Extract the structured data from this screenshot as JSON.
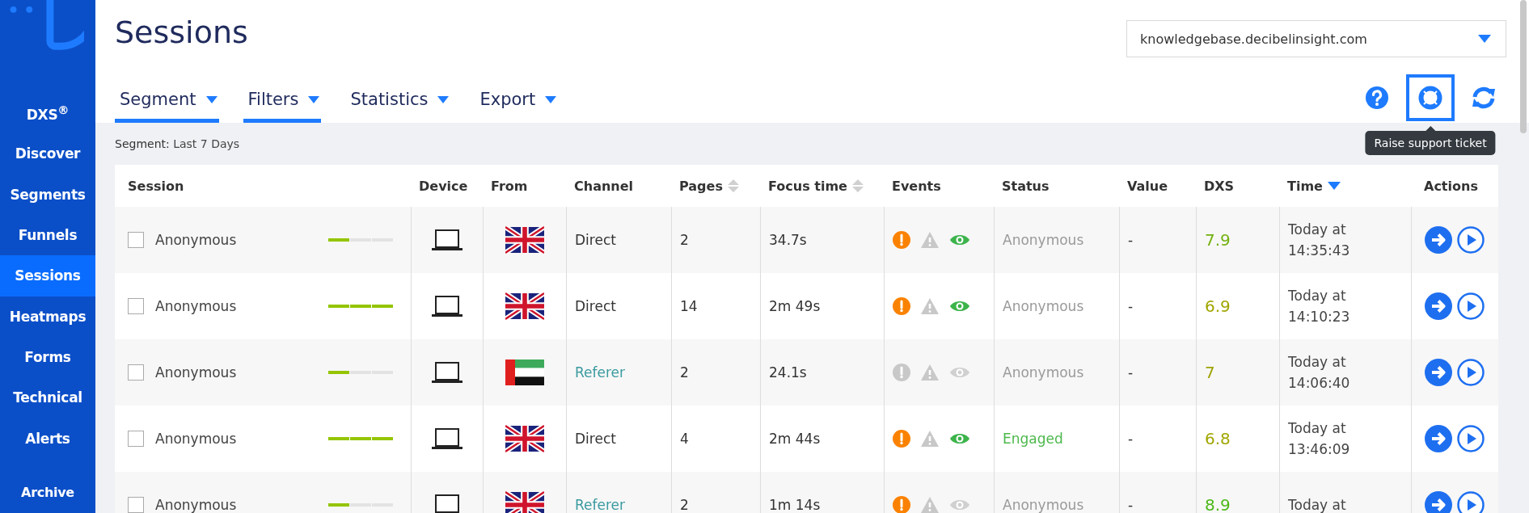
{
  "sidebar": {
    "items": [
      {
        "label": "DXS$^{®}$",
        "selected": false
      },
      {
        "label": "Discover",
        "selected": false
      },
      {
        "label": "Segments",
        "selected": false
      },
      {
        "label": "Funnels",
        "selected": false
      },
      {
        "label": "Sessions",
        "selected": true
      },
      {
        "label": "Heatmaps",
        "selected": false
      },
      {
        "label": "Forms",
        "selected": false
      },
      {
        "label": "Technical",
        "selected": false
      },
      {
        "label": "Alerts",
        "selected": false
      },
      {
        "label": "Archive",
        "selected": false
      }
    ]
  },
  "page_title": "Sessions",
  "site_select": {
    "value": "knowledgebase.decibelinsight.com"
  },
  "tabs": [
    {
      "label": "Segment",
      "selected": true
    },
    {
      "label": "Filters",
      "selected": true
    },
    {
      "label": "Statistics",
      "selected": false
    },
    {
      "label": "Export",
      "selected": false
    }
  ],
  "toolbar": [
    {
      "kind": "help",
      "highlighted": false
    },
    {
      "kind": "support",
      "highlighted": true,
      "tooltip": "Raise support ticket"
    },
    {
      "kind": "refresh",
      "highlighted": false
    }
  ],
  "segment_label": "Segment:",
  "segment_value": "Last 7 Days",
  "table": {
    "columns": [
      {
        "label": "Session"
      },
      {
        "label": "Device"
      },
      {
        "label": "From"
      },
      {
        "label": "Channel"
      },
      {
        "label": "Pages",
        "kind": "sortable"
      },
      {
        "label": "Focus time",
        "kind": "sortable"
      },
      {
        "label": "Events"
      },
      {
        "label": "Status"
      },
      {
        "label": "Value"
      },
      {
        "label": "DXS"
      },
      {
        "label": "Time",
        "kind": "sorted"
      },
      {
        "label": "Actions"
      }
    ],
    "rows": [
      {
        "checked": false,
        "session": "Anonymous",
        "level": 0.33,
        "from": {
          "kind": "uk"
        },
        "channel": {
          "text": "Direct",
          "color": "#333333"
        },
        "pages": "2",
        "focus_time": "34.7s",
        "events": {
          "error": true,
          "warning": false,
          "viewed": true
        },
        "status": {
          "text": "Anonymous",
          "color": "#9a9a9a"
        },
        "value": "-",
        "dxs": {
          "text": "7.9",
          "color": "#73b10f"
        },
        "time": "Today at 14:35:43"
      },
      {
        "checked": false,
        "session": "Anonymous",
        "level": 1,
        "from": {
          "kind": "uk"
        },
        "channel": {
          "text": "Direct",
          "color": "#333333"
        },
        "pages": "14",
        "focus_time": "2m 49s",
        "events": {
          "error": true,
          "warning": false,
          "viewed": true
        },
        "status": {
          "text": "Anonymous",
          "color": "#9a9a9a"
        },
        "value": "-",
        "dxs": {
          "text": "6.9",
          "color": "#a0a600"
        },
        "time": "Today at 14:10:23"
      },
      {
        "checked": false,
        "session": "Anonymous",
        "level": 0.33,
        "from": {
          "kind": "uae"
        },
        "channel": {
          "text": "Referer",
          "color": "#3a9a9f"
        },
        "pages": "2",
        "focus_time": "24.1s",
        "events": {
          "error": false,
          "warning": false,
          "viewed": false
        },
        "status": {
          "text": "Anonymous",
          "color": "#9a9a9a"
        },
        "value": "-",
        "dxs": {
          "text": "7",
          "color": "#9ea300"
        },
        "time": "Today at 14:06:40"
      },
      {
        "checked": false,
        "session": "Anonymous",
        "level": 1,
        "from": {
          "kind": "uk"
        },
        "channel": {
          "text": "Direct",
          "color": "#333333"
        },
        "pages": "4",
        "focus_time": "2m 44s",
        "events": {
          "error": true,
          "warning": false,
          "viewed": true
        },
        "status": {
          "text": "Engaged",
          "color": "#4cb84c"
        },
        "value": "-",
        "dxs": {
          "text": "6.8",
          "color": "#a0a600"
        },
        "time": "Today at 13:46:09"
      },
      {
        "checked": false,
        "session": "Anonymous",
        "level": 0.33,
        "from": {
          "kind": "uk"
        },
        "channel": {
          "text": "Referer",
          "color": "#3a9a9f"
        },
        "pages": "2",
        "focus_time": "1m 14s",
        "events": {
          "error": true,
          "warning": false,
          "viewed": false
        },
        "status": {
          "text": "Anonymous",
          "color": "#9a9a9a"
        },
        "value": "-",
        "dxs": {
          "text": "8.9",
          "color": "#4cb818"
        },
        "time": "Today at"
      }
    ]
  }
}
